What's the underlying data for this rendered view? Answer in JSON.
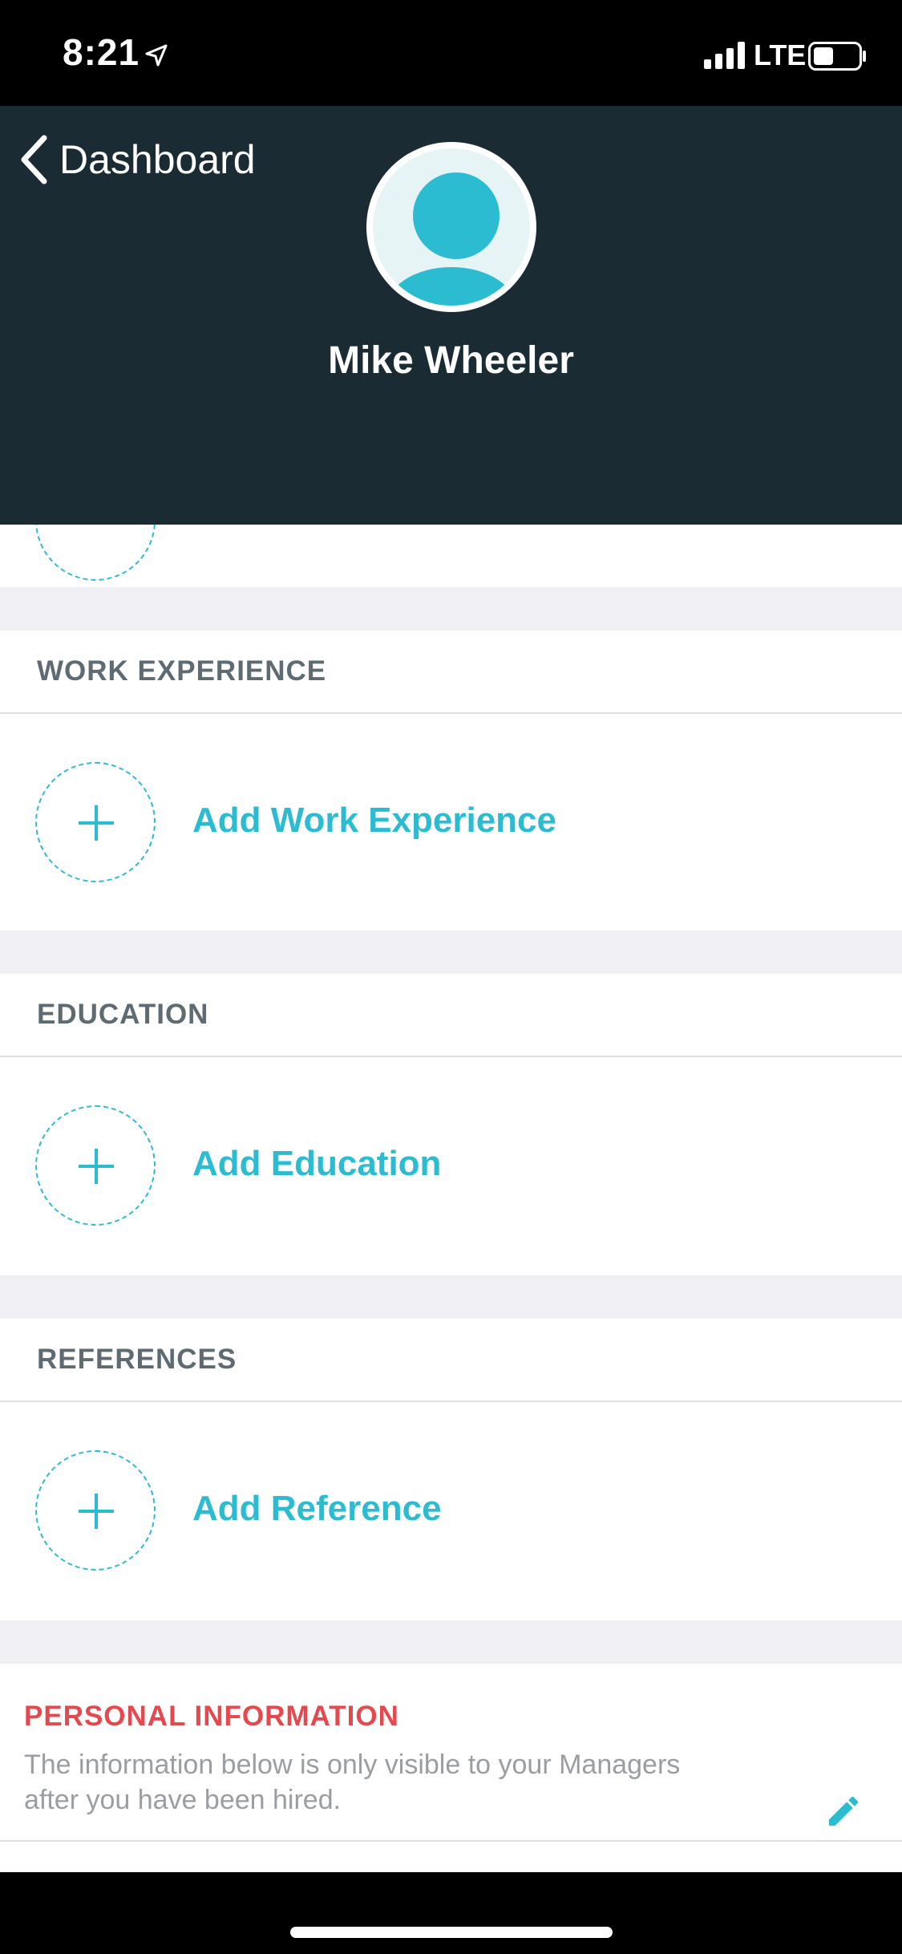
{
  "status_bar": {
    "time": "8:21",
    "network": "LTE"
  },
  "header": {
    "back_label": "Dashboard",
    "profile_name": "Mike Wheeler"
  },
  "sections": [
    {
      "title": "WORK EXPERIENCE",
      "add_label": "Add Work Experience"
    },
    {
      "title": "EDUCATION",
      "add_label": "Add Education"
    },
    {
      "title": "REFERENCES",
      "add_label": "Add Reference"
    }
  ],
  "personal": {
    "title": "PERSONAL INFORMATION",
    "description": "The information below is only visible to your Managers after you have been hired."
  },
  "colors": {
    "accent": "#2bbcd1",
    "header_bg": "#1b2b33",
    "alert": "#e5484d"
  }
}
